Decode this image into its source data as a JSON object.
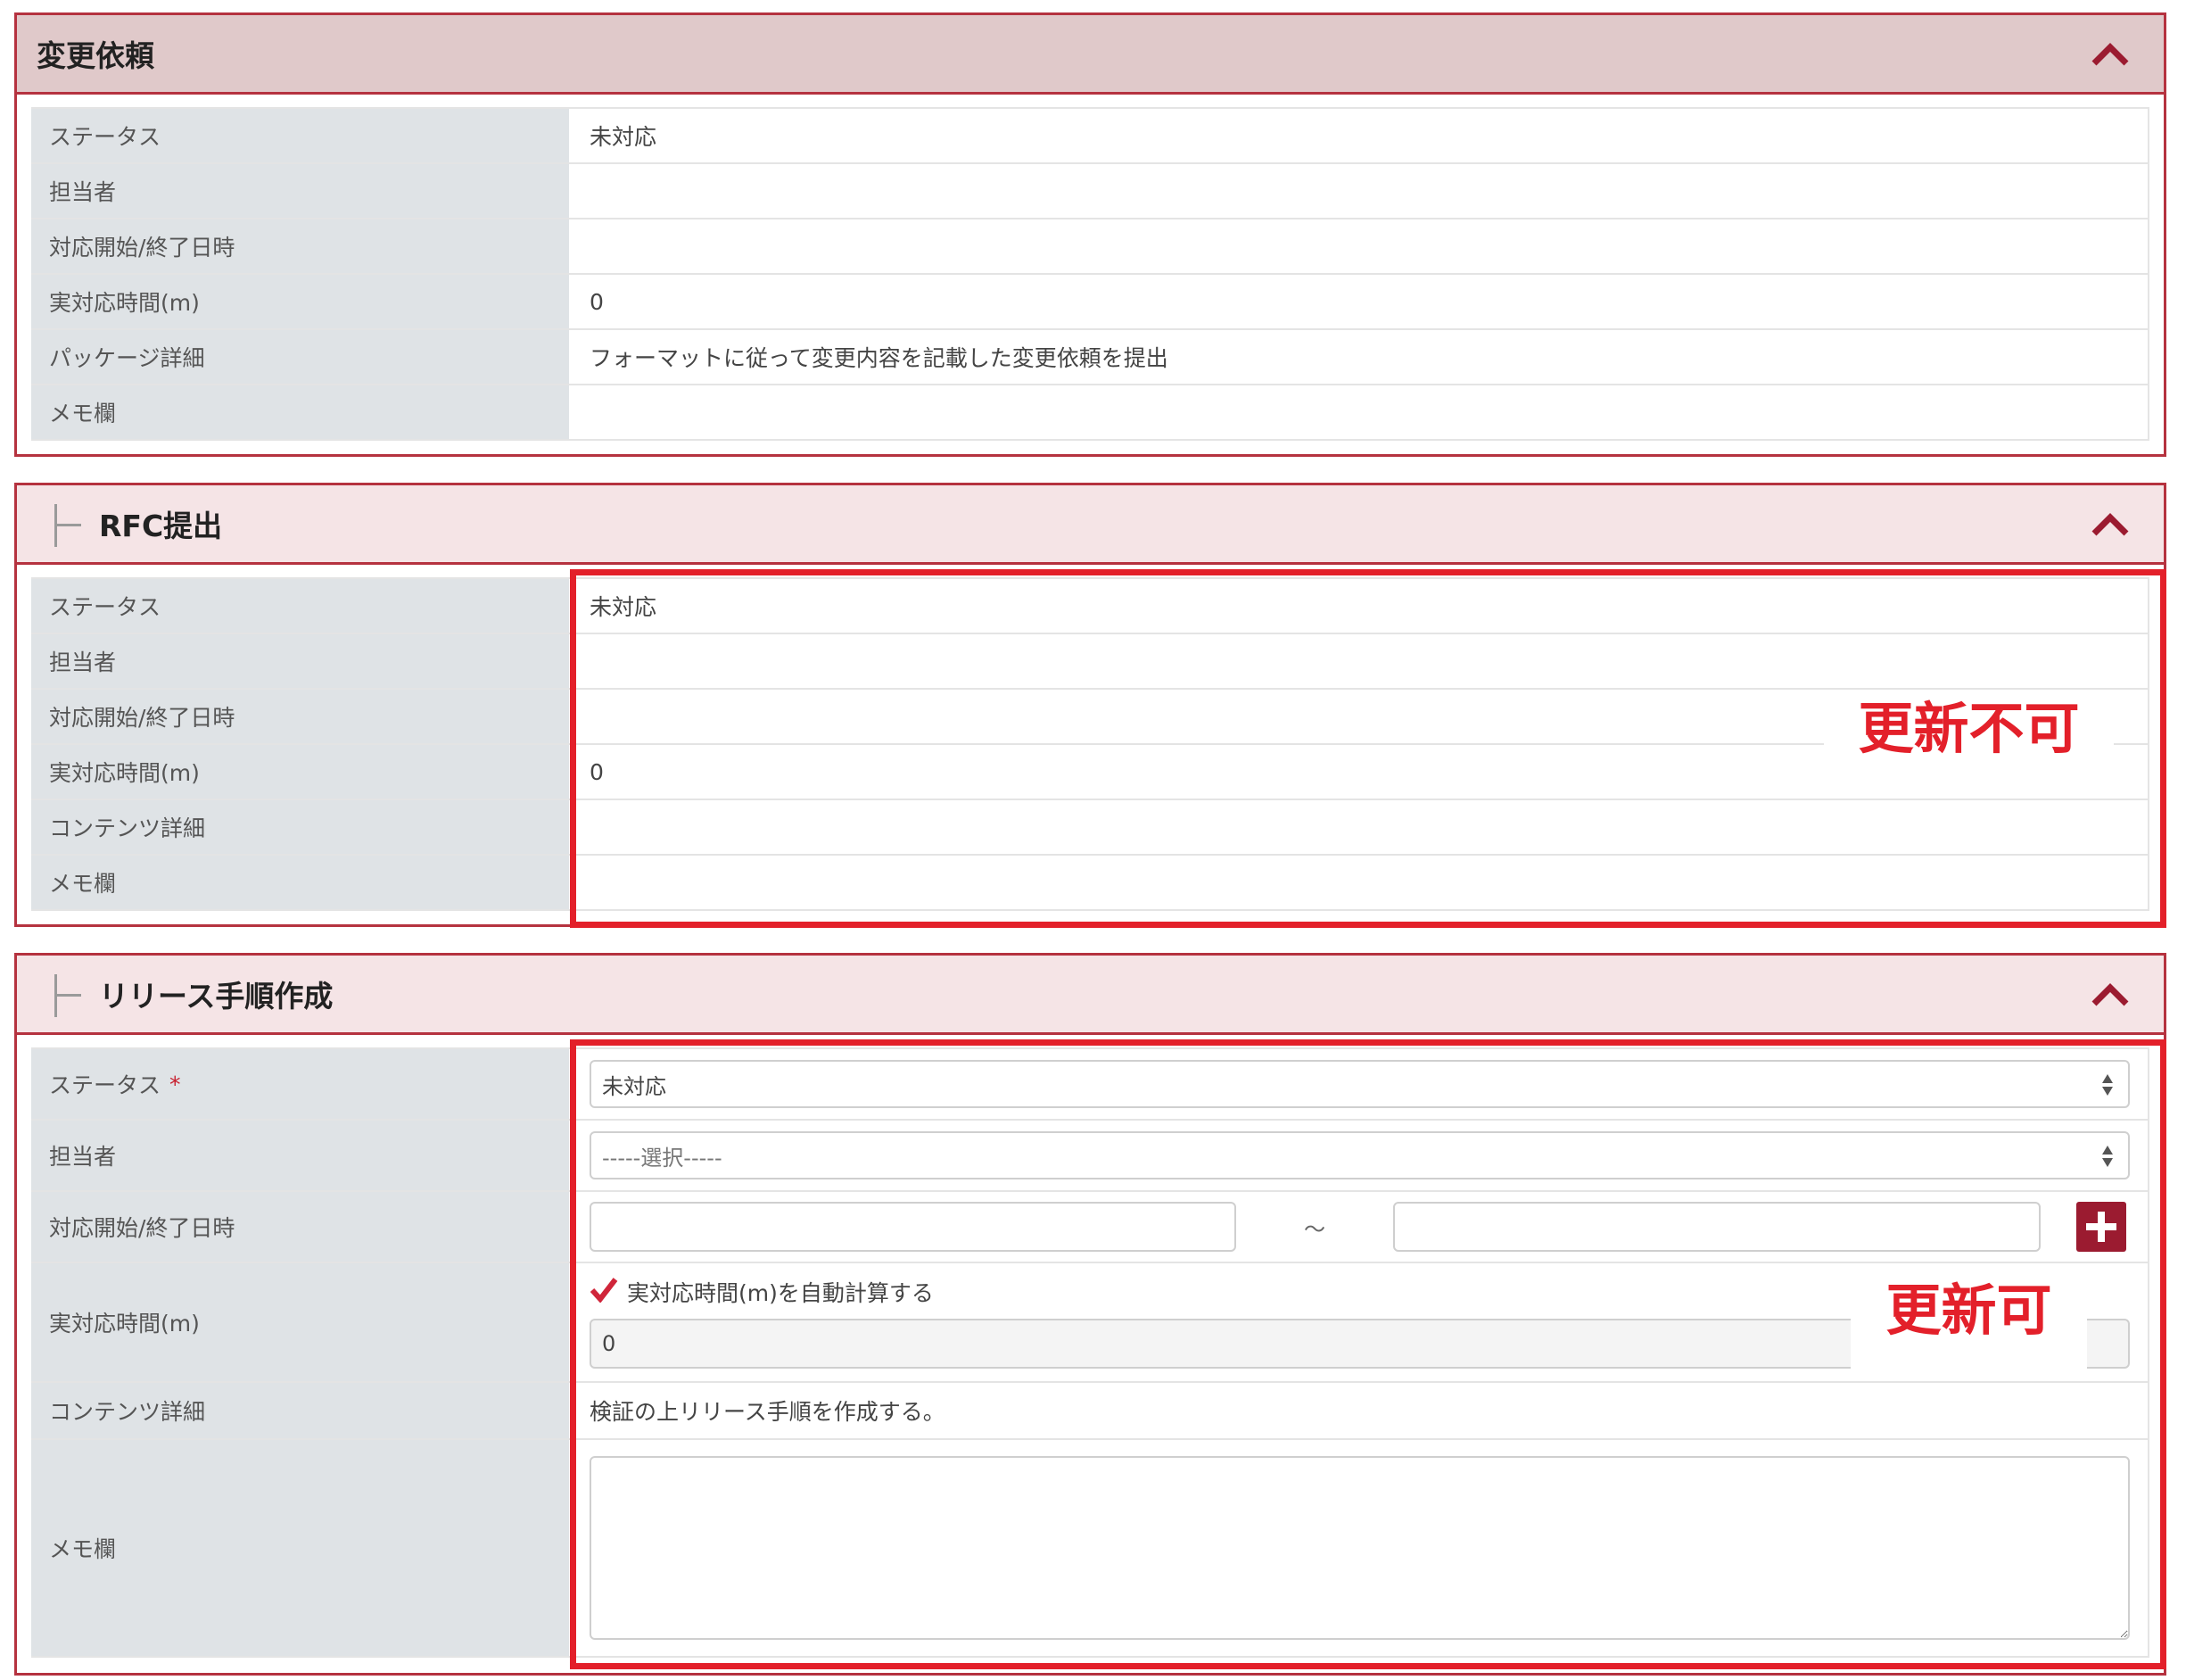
{
  "colors": {
    "accent": "#b5323f",
    "annotation": "#e3202a",
    "button": "#9b1b30"
  },
  "panel1": {
    "title": "変更依頼",
    "rows": [
      {
        "label": "ステータス",
        "value": "未対応"
      },
      {
        "label": "担当者",
        "value": ""
      },
      {
        "label": "対応開始/終了日時",
        "value": ""
      },
      {
        "label": "実対応時間(m)",
        "value": "0"
      },
      {
        "label": "パッケージ詳細",
        "value": "フォーマットに従って変更内容を記載した変更依頼を提出"
      },
      {
        "label": "メモ欄",
        "value": ""
      }
    ]
  },
  "panel2": {
    "title": "RFC提出",
    "rows": [
      {
        "label": "ステータス",
        "value": "未対応"
      },
      {
        "label": "担当者",
        "value": ""
      },
      {
        "label": "対応開始/終了日時",
        "value": ""
      },
      {
        "label": "実対応時間(m)",
        "value": "0"
      },
      {
        "label": "コンテンツ詳細",
        "value": ""
      },
      {
        "label": "メモ欄",
        "value": ""
      }
    ],
    "annotation": "更新不可"
  },
  "panel3": {
    "title": "リリース手順作成",
    "status": {
      "label": "ステータス",
      "required_mark": "*",
      "selected": "未対応"
    },
    "assignee": {
      "label": "担当者",
      "selected": "-----選択-----"
    },
    "period": {
      "label": "対応開始/終了日時",
      "start": "",
      "separator": "～",
      "end": ""
    },
    "time": {
      "label": "実対応時間(m)",
      "auto_calc_label": "実対応時間(m)を自動計算する",
      "value": "0"
    },
    "content": {
      "label": "コンテンツ詳細",
      "value": "検証の上リリース手順を作成する。"
    },
    "memo": {
      "label": "メモ欄",
      "value": ""
    },
    "annotation": "更新可"
  },
  "icons": {
    "collapse": "chevron-up-icon",
    "add": "plus-icon",
    "check": "checkmark-icon",
    "select": "select-arrows-icon"
  }
}
